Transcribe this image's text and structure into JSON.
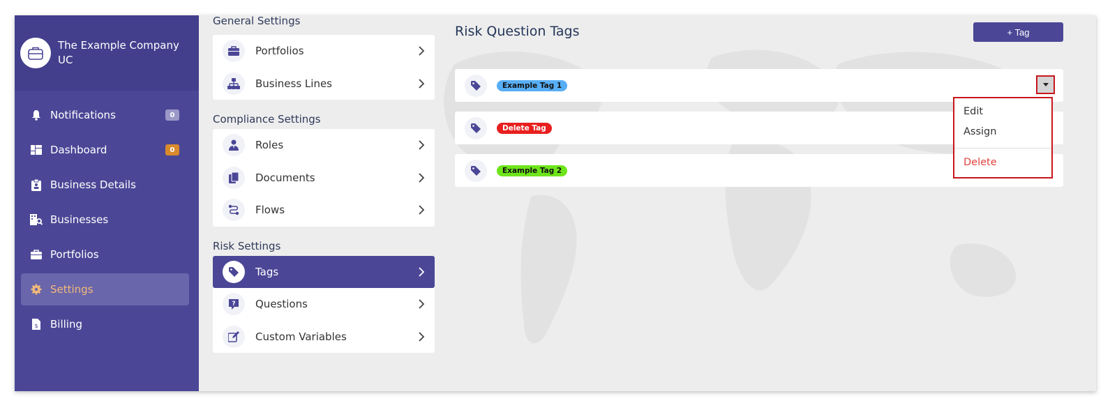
{
  "sidebar": {
    "company_name": "The Example Company UC",
    "items": [
      {
        "label": "Notifications",
        "icon": "bell-icon",
        "badge": "0"
      },
      {
        "label": "Dashboard",
        "icon": "dashboard-icon",
        "badge": "0"
      },
      {
        "label": "Business Details",
        "icon": "clipboard-icon"
      },
      {
        "label": "Businesses",
        "icon": "building-search-icon"
      },
      {
        "label": "Portfolios",
        "icon": "briefcase-icon"
      },
      {
        "label": "Settings",
        "icon": "gear-icon",
        "active": true
      },
      {
        "label": "Billing",
        "icon": "invoice-icon"
      }
    ]
  },
  "settings": {
    "general": {
      "title": "General Settings",
      "items": [
        {
          "label": "Portfolios",
          "icon": "briefcase-icon"
        },
        {
          "label": "Business Lines",
          "icon": "sitemap-icon"
        }
      ]
    },
    "compliance": {
      "title": "Compliance Settings",
      "items": [
        {
          "label": "Roles",
          "icon": "user-tie-icon"
        },
        {
          "label": "Documents",
          "icon": "documents-icon"
        },
        {
          "label": "Flows",
          "icon": "route-icon"
        }
      ]
    },
    "risk": {
      "title": "Risk Settings",
      "items": [
        {
          "label": "Tags",
          "icon": "tag-icon",
          "active": true
        },
        {
          "label": "Questions",
          "icon": "question-icon"
        },
        {
          "label": "Custom Variables",
          "icon": "edit-icon"
        }
      ]
    }
  },
  "main": {
    "title": "Risk Question Tags",
    "add_button": "+ Tag",
    "tags": [
      {
        "label": "Example Tag 1",
        "color": "#58aef5"
      },
      {
        "label": "Delete Tag",
        "color": "#e81f1f"
      },
      {
        "label": "Example Tag 2",
        "color": "#6ee51a"
      }
    ],
    "dropdown": {
      "items": [
        "Edit",
        "Assign"
      ],
      "danger": "Delete"
    }
  },
  "colors": {
    "sidebar": "#4b4796",
    "active_text": "#f2b97a",
    "highlight": "#c8161d"
  }
}
